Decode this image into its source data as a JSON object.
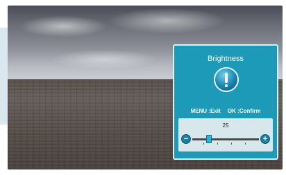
{
  "osd": {
    "title": "Brightness",
    "hint_menu": "MENU :Exit",
    "hint_ok": "OK :Confirm",
    "slider": {
      "value": "25",
      "minus": "−",
      "plus": "+",
      "fraction": 0.25
    }
  },
  "icons": {
    "info": "info-circle-icon"
  },
  "colors": {
    "panel": "#1d9ab7",
    "slider_bg": "#d8e7ec",
    "accent": "#29b6d6"
  }
}
